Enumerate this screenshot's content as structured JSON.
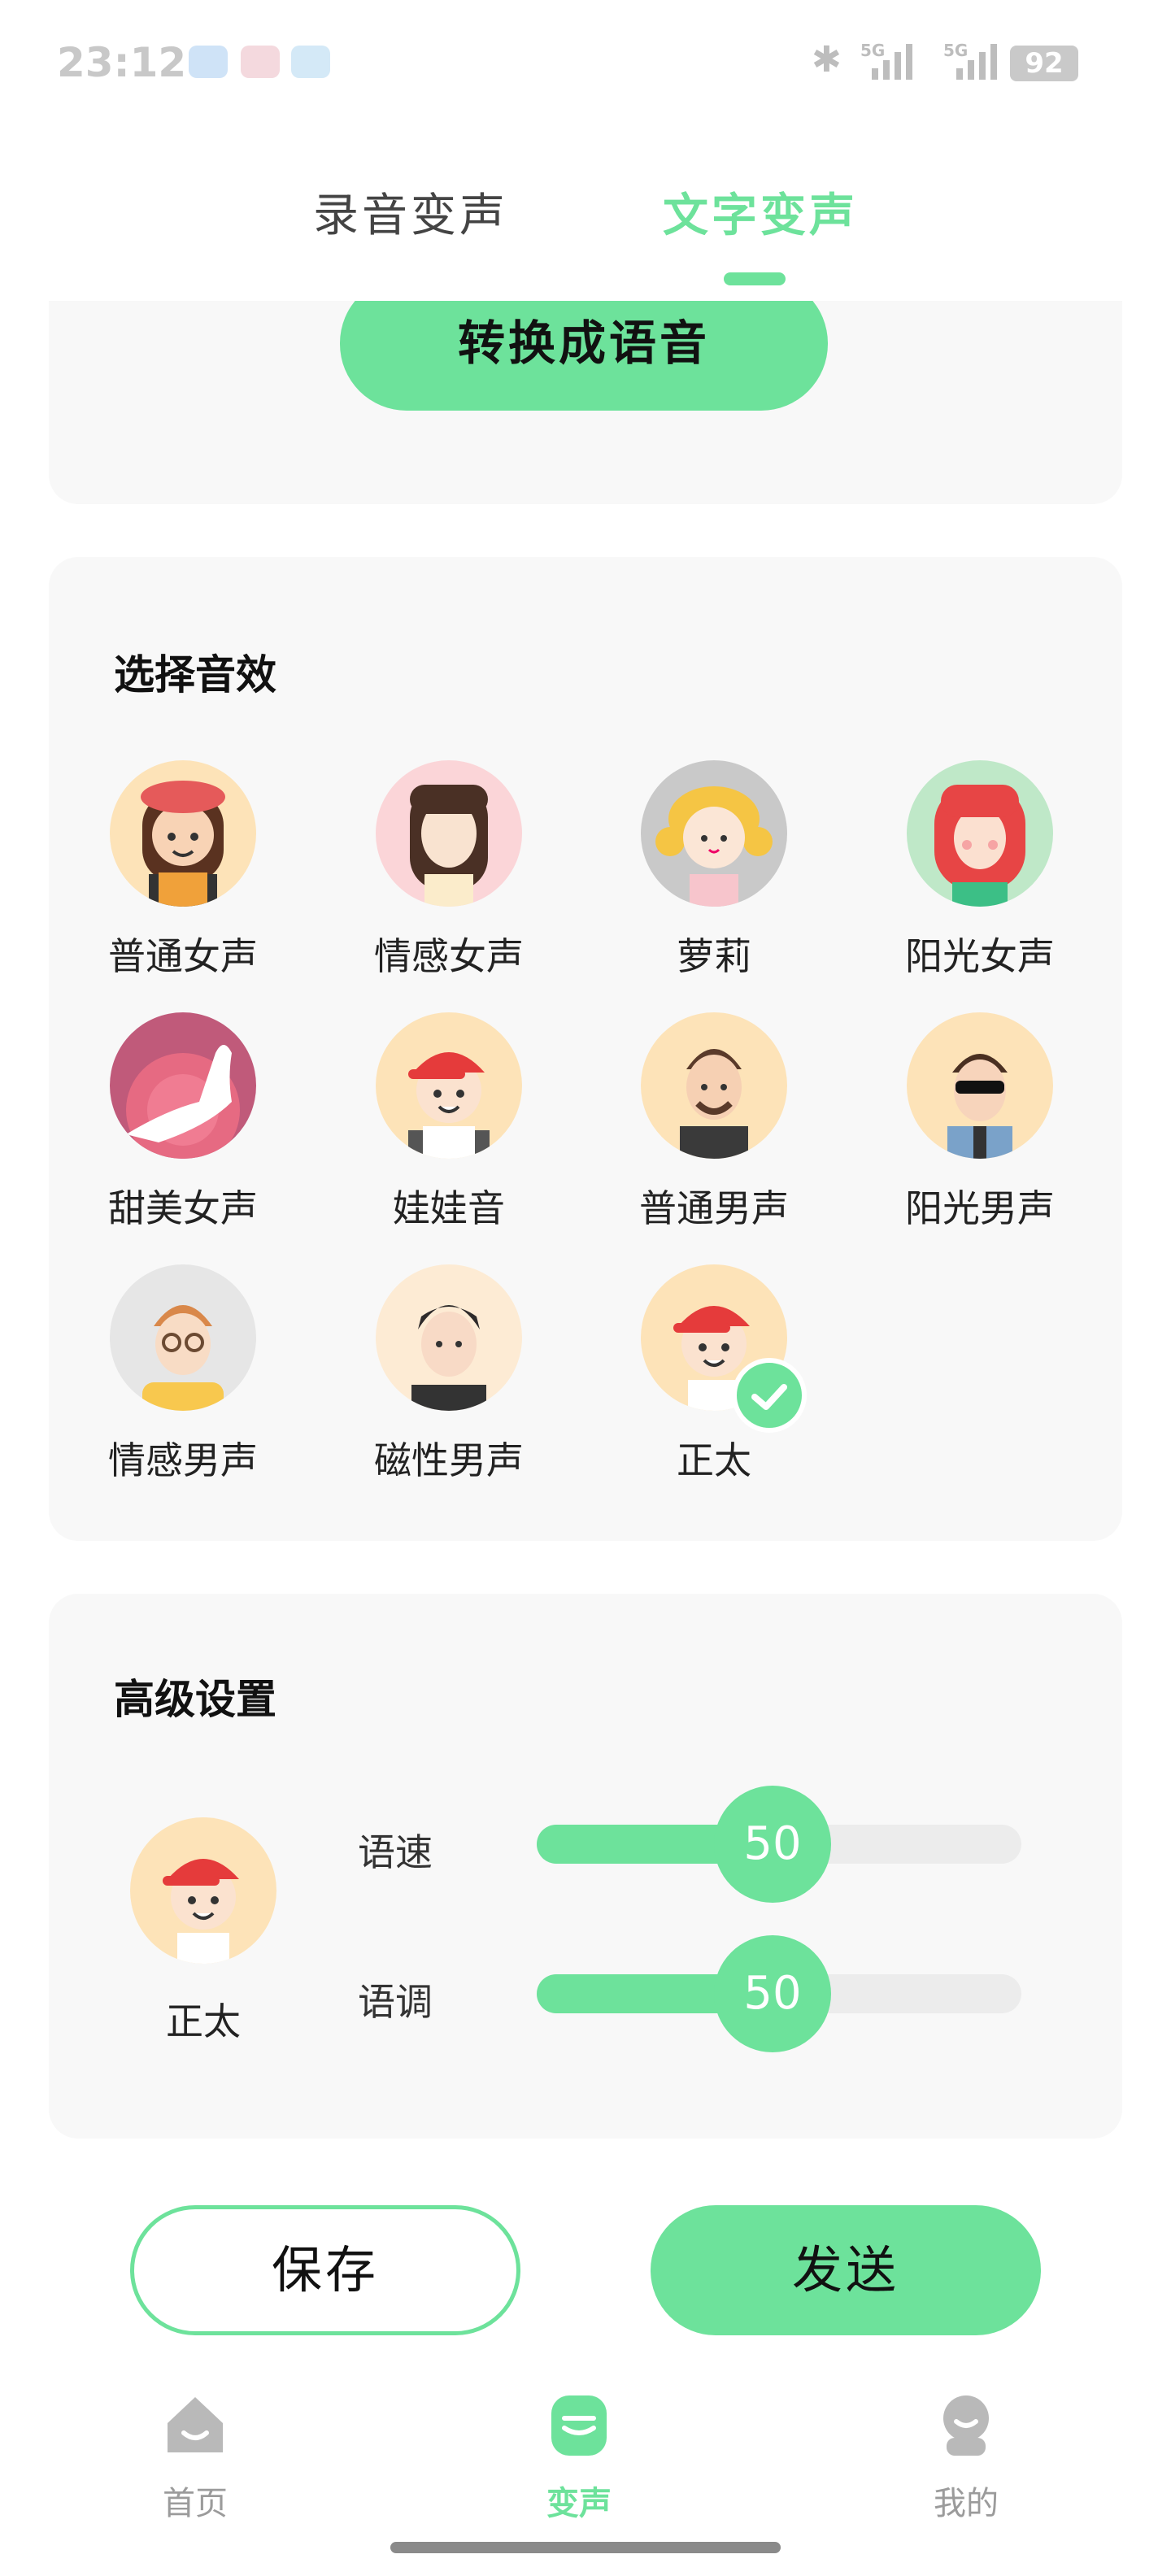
{
  "status_bar": {
    "time": "23:12",
    "battery": "92",
    "network": "5G"
  },
  "tabs": {
    "left_label": "录音变声",
    "right_label": "文字变声"
  },
  "convert_button": "转换成语音",
  "effects": {
    "title": "选择音效",
    "items": [
      {
        "label": "普通女声",
        "icon": "avatar-female-beret"
      },
      {
        "label": "情感女声",
        "icon": "avatar-female-long-hair"
      },
      {
        "label": "萝莉",
        "icon": "avatar-girl-blonde"
      },
      {
        "label": "阳光女声",
        "icon": "avatar-female-red-hair"
      },
      {
        "label": "甜美女声",
        "icon": "avatar-female-silhouette"
      },
      {
        "label": "娃娃音",
        "icon": "avatar-kid-red-cap"
      },
      {
        "label": "普通男声",
        "icon": "avatar-male-beard"
      },
      {
        "label": "阳光男声",
        "icon": "avatar-male-sunglasses"
      },
      {
        "label": "情感男声",
        "icon": "avatar-male-glasses"
      },
      {
        "label": "磁性男声",
        "icon": "avatar-male-dark-hair"
      },
      {
        "label": "正太",
        "icon": "avatar-boy-red-cap"
      }
    ],
    "selected": "正太"
  },
  "advanced": {
    "title": "高级设置",
    "selected_voice": "正太",
    "speed_label": "语速",
    "speed_value": "50",
    "pitch_label": "语调",
    "pitch_value": "50"
  },
  "actions": {
    "save_label": "保存",
    "send_label": "发送"
  },
  "bottom_nav": {
    "home_label": "首页",
    "voice_label": "变声",
    "mine_label": "我的"
  },
  "colors": {
    "accent": "#6de29b",
    "card_bg": "#f8f8f8"
  }
}
